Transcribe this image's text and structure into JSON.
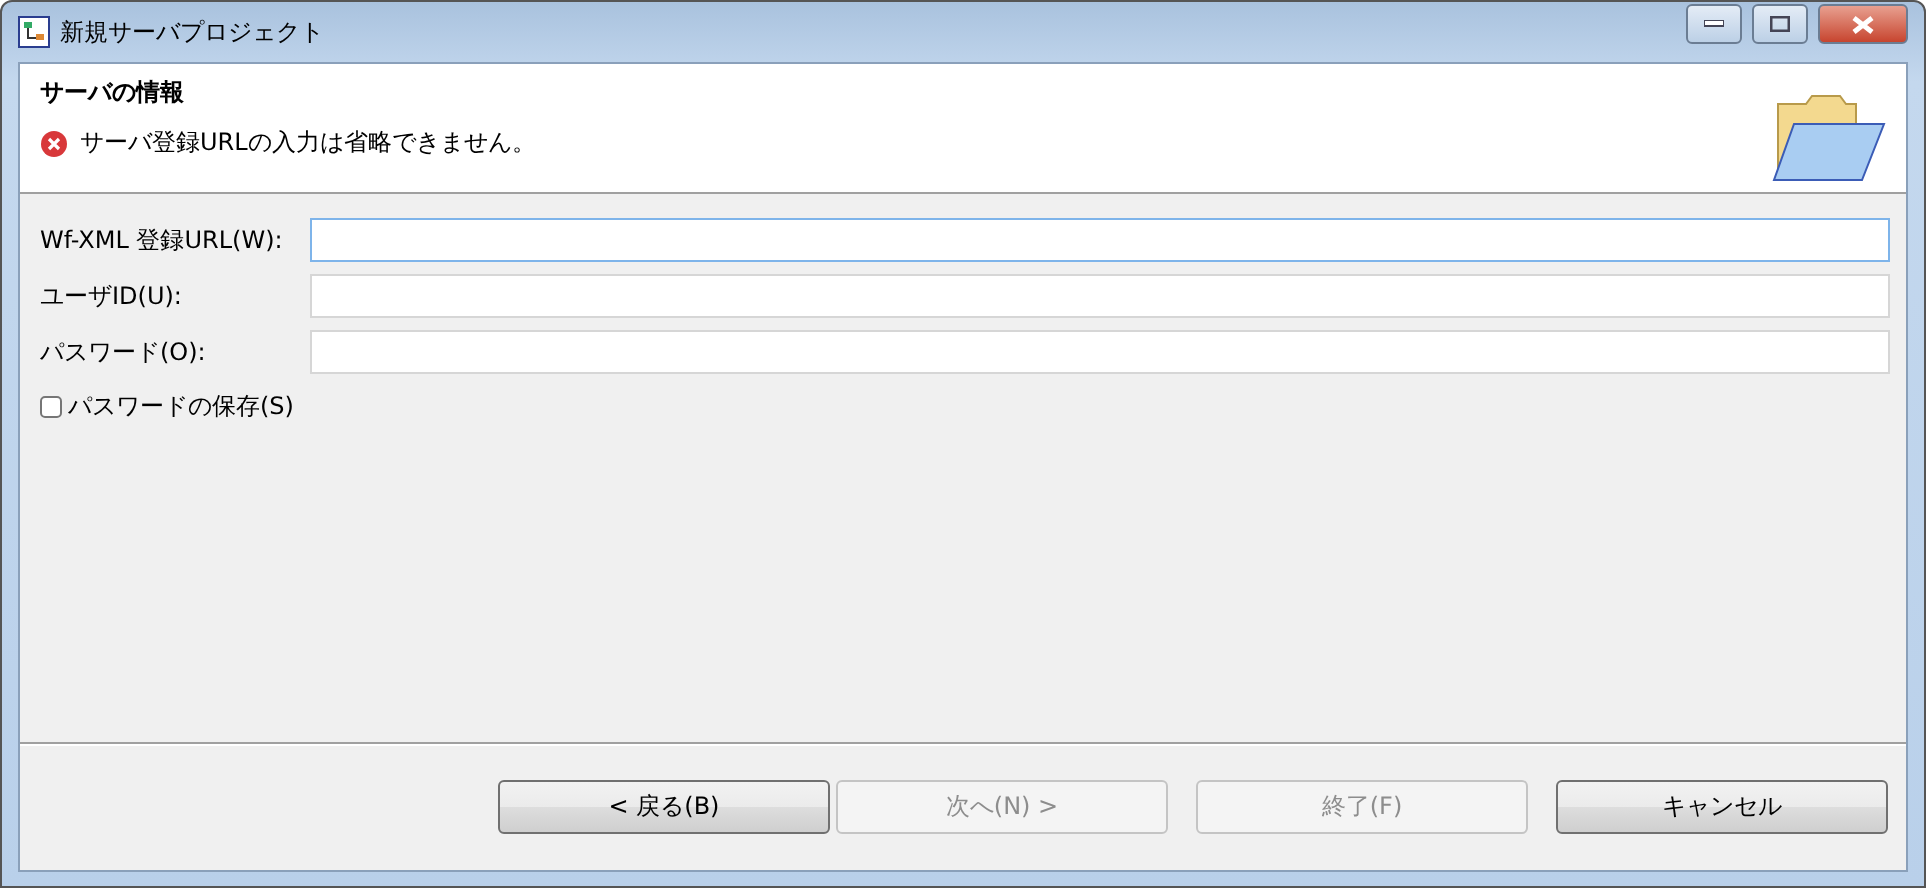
{
  "window": {
    "title": "新規サーバプロジェクト"
  },
  "header": {
    "title": "サーバの情報",
    "message": "サーバ登録URLの入力は省略できません。"
  },
  "fields": [
    {
      "label": "Wf-XML 登録URL(W):",
      "focused": true
    },
    {
      "label": "ユーザID(U):",
      "focused": false
    },
    {
      "label": "パスワード(O):",
      "focused": false
    }
  ],
  "save_password": {
    "label": "パスワードの保存(S)",
    "checked": false
  },
  "buttons": [
    {
      "label": "< 戻る(B)",
      "disabled": false
    },
    {
      "label": "次へ(N) >",
      "disabled": true
    },
    {
      "label": "終了(F)",
      "disabled": true
    },
    {
      "label": "キャンセル",
      "disabled": false
    }
  ]
}
